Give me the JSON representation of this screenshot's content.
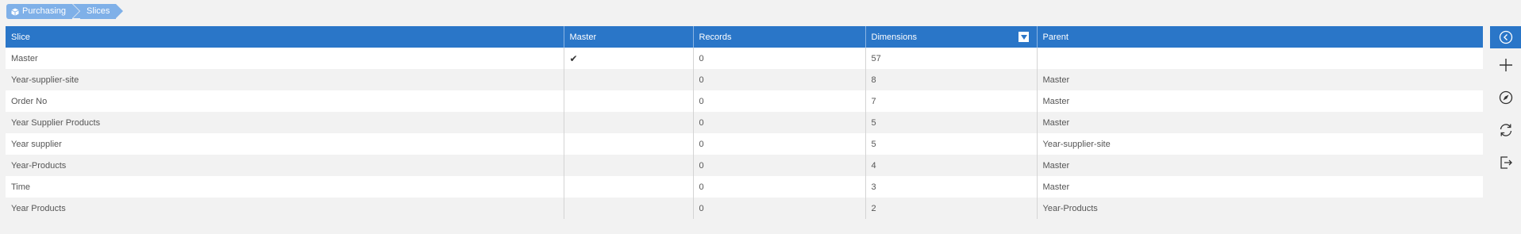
{
  "breadcrumb": [
    {
      "label": "Purchasing"
    },
    {
      "label": "Slices"
    }
  ],
  "table": {
    "columns": [
      "Slice",
      "Master",
      "Records",
      "Dimensions",
      "Parent"
    ],
    "rows": [
      {
        "slice": "Master",
        "master": "✔",
        "records": "0",
        "dimensions": "57",
        "parent": ""
      },
      {
        "slice": "Year-supplier-site",
        "master": "",
        "records": "0",
        "dimensions": "8",
        "parent": "Master"
      },
      {
        "slice": "Order No",
        "master": "",
        "records": "0",
        "dimensions": "7",
        "parent": "Master"
      },
      {
        "slice": "Year Supplier Products",
        "master": "",
        "records": "0",
        "dimensions": "5",
        "parent": "Master"
      },
      {
        "slice": "Year supplier",
        "master": "",
        "records": "0",
        "dimensions": "5",
        "parent": "Year-supplier-site"
      },
      {
        "slice": "Year-Products",
        "master": "",
        "records": "0",
        "dimensions": "4",
        "parent": "Master"
      },
      {
        "slice": "Time",
        "master": "",
        "records": "0",
        "dimensions": "3",
        "parent": "Master"
      },
      {
        "slice": "Year Products",
        "master": "",
        "records": "0",
        "dimensions": "2",
        "parent": "Year-Products"
      }
    ]
  },
  "toolbar": {
    "items": [
      "collapse-icon",
      "add-icon",
      "compass-icon",
      "refresh-icon",
      "export-icon"
    ]
  },
  "colors": {
    "header": "#2a76c8",
    "breadcrumb": "#7fb0e8",
    "row_alt": "#f2f2f2"
  }
}
